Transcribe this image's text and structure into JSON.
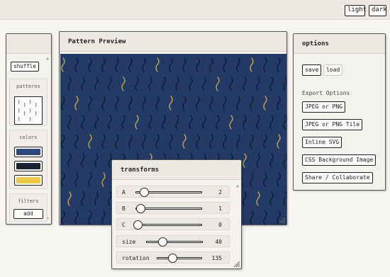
{
  "theme": {
    "light_label": "light",
    "dark_label": "dark"
  },
  "sidebar": {
    "shuffle_label": "shuffle",
    "patterns_label": "patterns",
    "colors_label": "colors",
    "colors": [
      "#2c4a7c",
      "#1b2233",
      "#ecc94b"
    ],
    "filters_label": "filters",
    "add_label": "add"
  },
  "preview": {
    "title": "Pattern Preview",
    "background": "#233a66",
    "accent": "#c9a648"
  },
  "options": {
    "title": "options",
    "save_label": "save",
    "load_label": "load",
    "export_heading": "Export Options",
    "export_buttons": [
      "JPEG or PNG",
      "JPEG or PNG Tile",
      "Inline SVG",
      "CSS Background Image",
      "Share / Collaborate"
    ]
  },
  "transforms": {
    "title": "transforms",
    "rows": [
      {
        "label": "A",
        "value": "2",
        "level": 0.11
      },
      {
        "label": "B",
        "value": "1",
        "level": 0.05
      },
      {
        "label": "C",
        "value": "0",
        "level": 0.0
      },
      {
        "label": "size",
        "value": "40",
        "level": 0.3
      },
      {
        "label": "rotation",
        "value": "135",
        "level": 0.375
      }
    ]
  }
}
